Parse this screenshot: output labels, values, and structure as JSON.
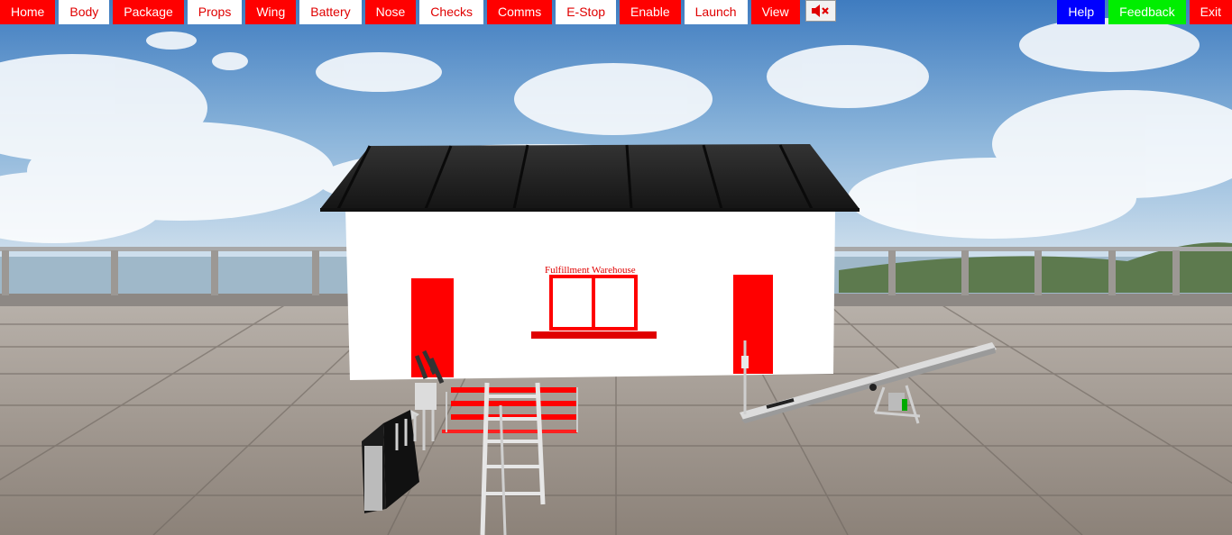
{
  "toolbar": {
    "left": [
      {
        "label": "Home",
        "style": "red"
      },
      {
        "label": "Body",
        "style": "white"
      },
      {
        "label": "Package",
        "style": "red"
      },
      {
        "label": "Props",
        "style": "white"
      },
      {
        "label": "Wing",
        "style": "red"
      },
      {
        "label": "Battery",
        "style": "white"
      },
      {
        "label": "Nose",
        "style": "red"
      },
      {
        "label": "Checks",
        "style": "white"
      },
      {
        "label": "Comms",
        "style": "red"
      },
      {
        "label": "E-Stop",
        "style": "white"
      },
      {
        "label": "Enable",
        "style": "red"
      },
      {
        "label": "Launch",
        "style": "white"
      },
      {
        "label": "View",
        "style": "red"
      }
    ],
    "mute_icon": "speaker-mute-icon",
    "right": [
      {
        "label": "Help",
        "style": "blue"
      },
      {
        "label": "Feedback",
        "style": "green"
      },
      {
        "label": "Exit",
        "style": "red"
      }
    ]
  },
  "scene": {
    "warehouse_sign": "Fulfillment Warehouse"
  },
  "colors": {
    "accent_red": "#ff0000",
    "help_blue": "#0000ff",
    "feedback_green": "#00ee00"
  }
}
